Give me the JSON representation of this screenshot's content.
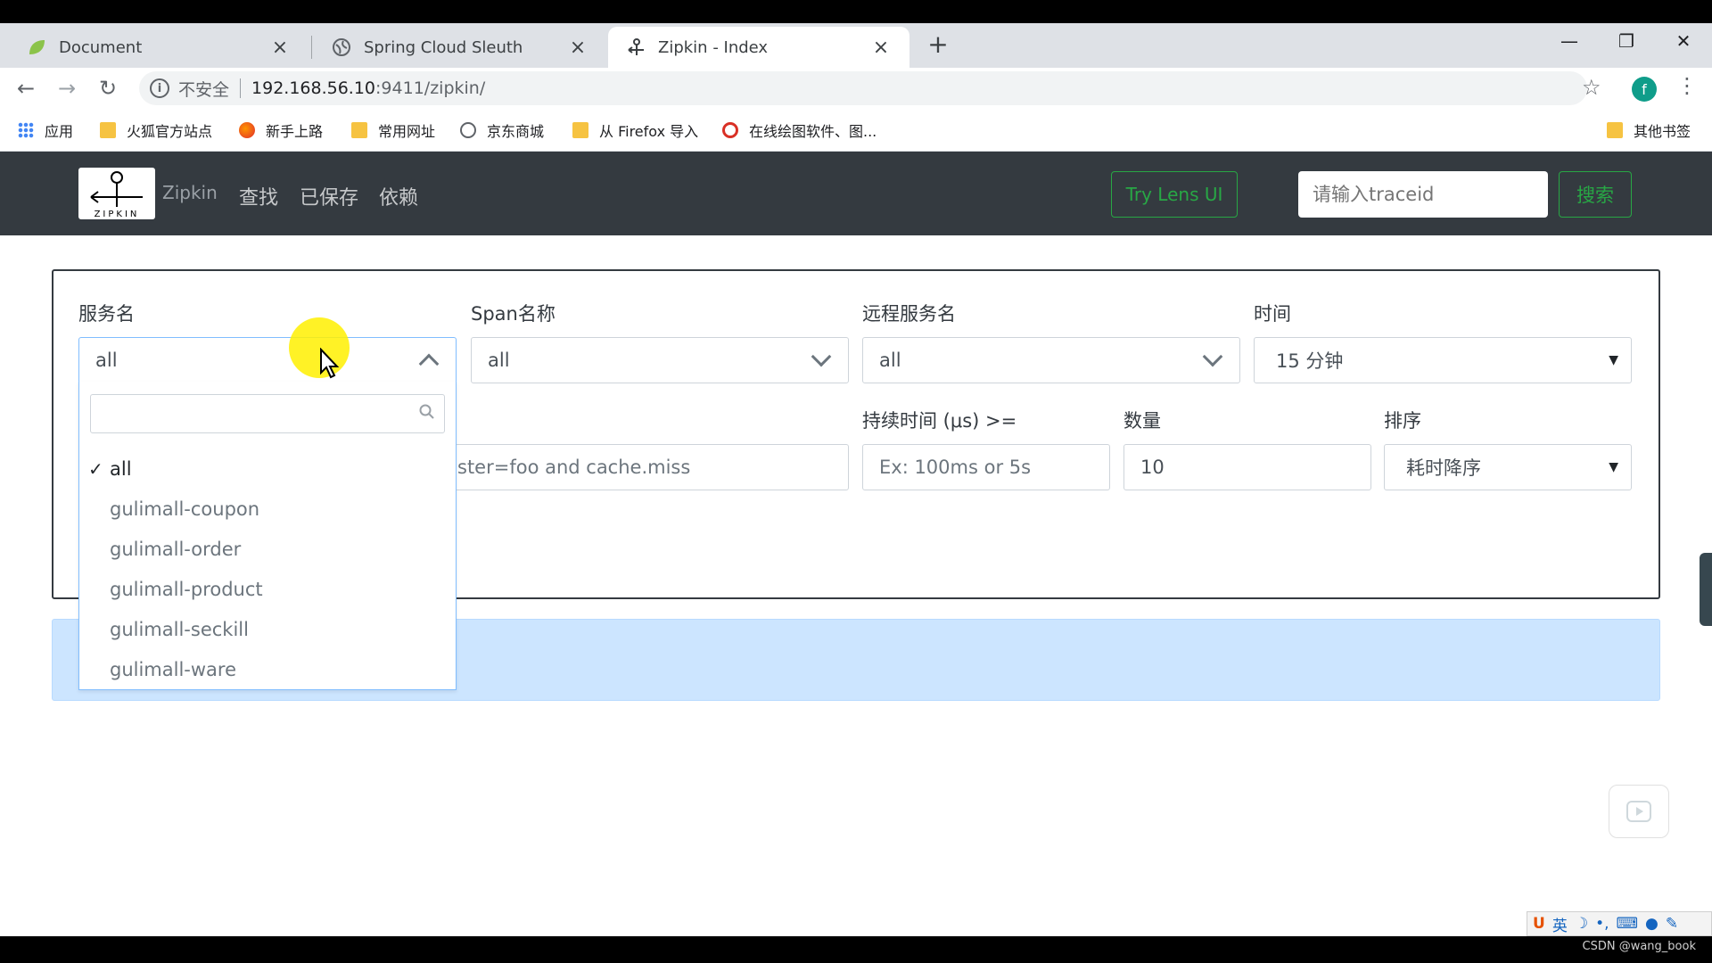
{
  "browser": {
    "tabs": [
      {
        "title": "Document",
        "icon": "leaf-icon"
      },
      {
        "title": "Spring Cloud Sleuth",
        "icon": "globe-icon"
      },
      {
        "title": "Zipkin - Index",
        "icon": "zipkin-icon",
        "active": true
      }
    ],
    "address": {
      "security_label": "不安全",
      "host": "192.168.56.10",
      "path": ":9411/zipkin/"
    },
    "bookmarks": [
      {
        "label": "应用",
        "icon": "apps-icon"
      },
      {
        "label": "火狐官方站点",
        "icon": "folder-icon"
      },
      {
        "label": "新手上路",
        "icon": "firefox-icon"
      },
      {
        "label": "常用网址",
        "icon": "folder-icon"
      },
      {
        "label": "京东商城",
        "icon": "globe-icon"
      },
      {
        "label": "从 Firefox 导入",
        "icon": "folder-icon"
      },
      {
        "label": "在线绘图软件、图...",
        "icon": "draw-icon"
      }
    ],
    "other_bookmarks": "其他书签",
    "profile_initial": "f"
  },
  "zipkin": {
    "brand": "Zipkin",
    "logo_text": "ZIPKIN",
    "nav": [
      "查找",
      "已保存",
      "依赖"
    ],
    "try_lens_label": "Try Lens UI",
    "traceid_placeholder": "请输入traceid",
    "search_label": "搜索",
    "colors": {
      "navbar": "#343a40",
      "accent": "#28a745",
      "info": "#cce5ff"
    }
  },
  "filters": {
    "service_label": "服务名",
    "service_value": "all",
    "span_label": "Span名称",
    "span_value": "all",
    "remote_label": "远程服务名",
    "remote_value": "all",
    "time_label": "时间",
    "time_value": "15 分钟",
    "annotation_placeholder_visible": "ster=foo and cache.miss",
    "duration_label": "持续时间 (μs) >=",
    "duration_placeholder": "Ex: 100ms or 5s",
    "limit_label": "数量",
    "limit_value": "10",
    "sort_label": "排序",
    "sort_value": "耗时降序"
  },
  "service_dropdown": {
    "options": [
      "all",
      "gulimall-coupon",
      "gulimall-order",
      "gulimall-product",
      "gulimall-seckill",
      "gulimall-ware"
    ],
    "selected": "all"
  },
  "system": {
    "ime_lang": "英",
    "watermark": "CSDN @wang_book"
  }
}
